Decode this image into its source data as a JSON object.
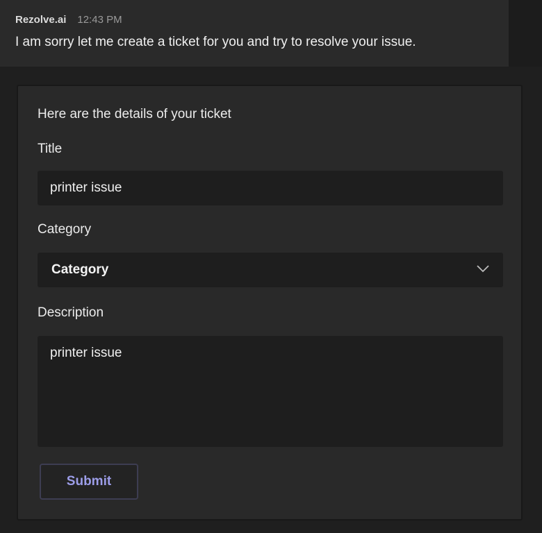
{
  "message": {
    "sender": "Rezolve.ai",
    "time": "12:43 PM",
    "text": "I am sorry let me create a ticket for you and try to resolve your issue."
  },
  "card": {
    "intro": "Here are the details of your ticket",
    "title_label": "Title",
    "title_value": "printer issue",
    "category_label": "Category",
    "category_value": "Category",
    "description_label": "Description",
    "description_value": "printer issue",
    "submit_label": "Submit"
  },
  "icons": {
    "category_dropdown": "chevron-down-icon"
  },
  "colors": {
    "submit_text": "#9c9de8",
    "submit_border": "#3d3d52",
    "background": "#1f1f1f",
    "card_background": "#292929",
    "input_background": "#1e1e1e"
  }
}
